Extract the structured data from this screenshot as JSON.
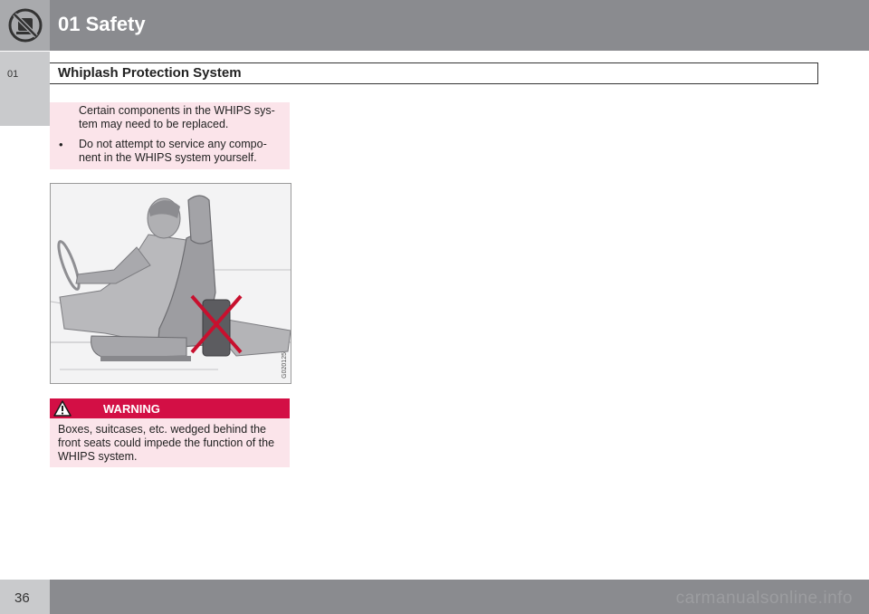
{
  "header": {
    "chapter_title": "01 Safety",
    "logo_icon": "no-child-seat-icon"
  },
  "side_tab": {
    "label": "01"
  },
  "section": {
    "title": "Whiplash Protection System"
  },
  "note": {
    "continuation": "Certain components in the WHIPS sys-\ntem may need to be replaced.",
    "bullet_symbol": "•",
    "bullet_text": "Do not attempt to service any compo-\nnent in the WHIPS system yourself."
  },
  "figure": {
    "code": "G020125",
    "description_icon": "whips-prohibited-object-illustration"
  },
  "warning": {
    "title": "WARNING",
    "icon": "warning-triangle-icon",
    "text": "Boxes, suitcases, etc. wedged behind the front seats could impede the function of the WHIPS system."
  },
  "footer": {
    "page_number": "36",
    "watermark": "carmanualsonline.info"
  },
  "colors": {
    "header_gray": "#8a8b8f",
    "warning_red": "#d30f45",
    "note_pink": "#fbe4ea",
    "cross_red": "#c8102e"
  }
}
